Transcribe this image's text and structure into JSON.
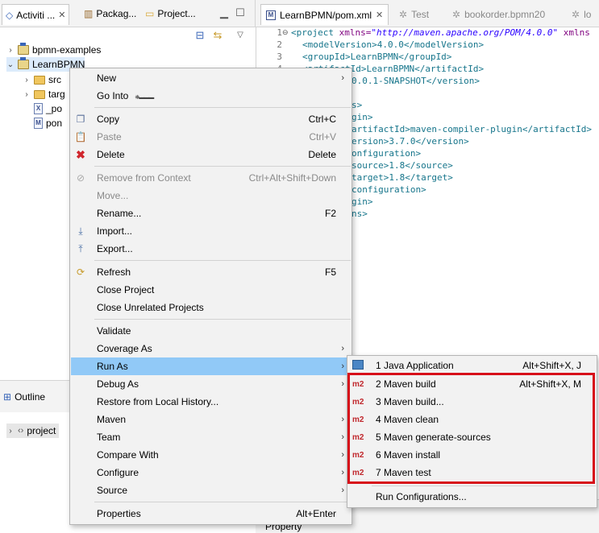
{
  "explorer": {
    "tabs": [
      {
        "label": "Activiti ...",
        "close": "✕"
      },
      {
        "label": "Packag..."
      },
      {
        "label": "Project..."
      }
    ],
    "tree": [
      {
        "label": "bpmn-examples"
      },
      {
        "label": "LearnBPMN"
      },
      {
        "label": "src"
      },
      {
        "label": "targ"
      },
      {
        "label": "_po"
      },
      {
        "label": "pon"
      }
    ]
  },
  "outline": {
    "title": "Outline",
    "item": "project"
  },
  "editor": {
    "tabs": [
      {
        "label": "LearnBPMN/pom.xml",
        "close": "✕"
      },
      {
        "label": "Test"
      },
      {
        "label": "bookorder.bpmn20"
      },
      {
        "label": "lo"
      }
    ],
    "line_numbers": [
      "1",
      "2",
      "3",
      "4"
    ],
    "code": {
      "line1_tag": "<project",
      "line1_attr": " xmlns=",
      "line1_str": "\"http://maven.apache.org/POM/4.0.0\"",
      "line1_tail": " xmlns",
      "line2": "<modelVersion>4.0.0</modelVersion>",
      "line3": "<groupId>LearnBPMN</groupId>",
      "line4": "<artifactId>LearnBPMN</artifactId>",
      "line5": "0.0.1-SNAPSHOT</version>",
      "line6": "s>",
      "line7": "gin>",
      "line8": "artifactId>maven-compiler-plugin</artifactId>",
      "line9": "ersion>3.7.0</version>",
      "line10": "onfiguration>",
      "line11": "source>1.8</source>",
      "line12": "target>1.8</target>",
      "line13": "configuration>",
      "line14": "gin>",
      "line15": "ns>"
    },
    "bottom_text": "Property"
  },
  "context_menu": {
    "items": {
      "new": {
        "label": "New"
      },
      "go_into": {
        "label": "Go Into"
      },
      "copy": {
        "label": "Copy",
        "shortcut": "Ctrl+C"
      },
      "paste": {
        "label": "Paste",
        "shortcut": "Ctrl+V"
      },
      "delete": {
        "label": "Delete",
        "shortcut": "Delete"
      },
      "remove_ctx": {
        "label": "Remove from Context",
        "shortcut": "Ctrl+Alt+Shift+Down"
      },
      "move": {
        "label": "Move..."
      },
      "rename": {
        "label": "Rename...",
        "shortcut": "F2"
      },
      "import": {
        "label": "Import..."
      },
      "export": {
        "label": "Export..."
      },
      "refresh": {
        "label": "Refresh",
        "shortcut": "F5"
      },
      "close_project": {
        "label": "Close Project"
      },
      "close_unrelated": {
        "label": "Close Unrelated Projects"
      },
      "validate": {
        "label": "Validate"
      },
      "coverage_as": {
        "label": "Coverage As"
      },
      "run_as": {
        "label": "Run As"
      },
      "debug_as": {
        "label": "Debug As"
      },
      "restore_history": {
        "label": "Restore from Local History..."
      },
      "maven": {
        "label": "Maven"
      },
      "team": {
        "label": "Team"
      },
      "compare_with": {
        "label": "Compare With"
      },
      "configure": {
        "label": "Configure"
      },
      "source": {
        "label": "Source"
      },
      "properties": {
        "label": "Properties",
        "shortcut": "Alt+Enter"
      }
    }
  },
  "run_as_submenu": {
    "items": [
      {
        "icon": "java-app-icon",
        "label": "1 Java Application",
        "shortcut": "Alt+Shift+X, J"
      },
      {
        "icon": "m2",
        "label": "2 Maven build",
        "shortcut": "Alt+Shift+X, M"
      },
      {
        "icon": "m2",
        "label": "3 Maven build..."
      },
      {
        "icon": "m2",
        "label": "4 Maven clean"
      },
      {
        "icon": "m2",
        "label": "5 Maven generate-sources"
      },
      {
        "icon": "m2",
        "label": "6 Maven install"
      },
      {
        "icon": "m2",
        "label": "7 Maven test"
      },
      {
        "label": "Run Configurations..."
      }
    ],
    "highlight_color": "#d7101a"
  },
  "colors": {
    "menu_highlight": "#91c9f7",
    "xml_tag": "#16758b",
    "xml_string": "#2a00ff"
  }
}
